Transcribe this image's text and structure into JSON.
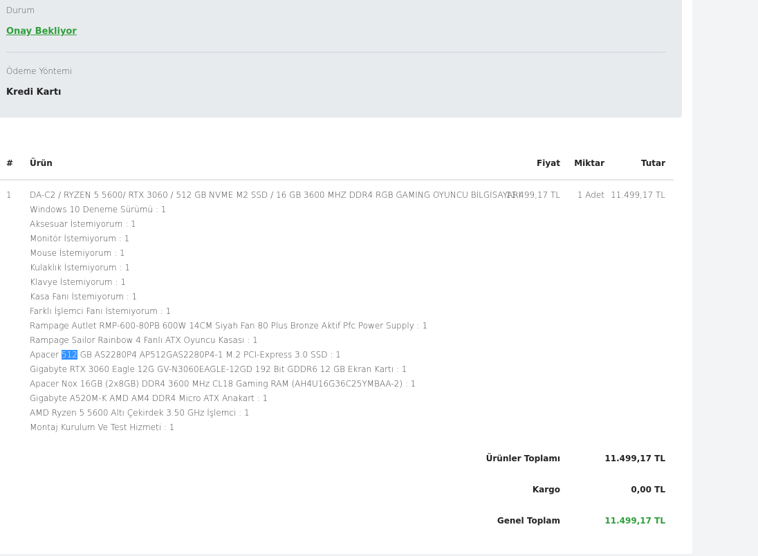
{
  "order": {
    "status_label": "Durum",
    "status_value": "Onay Bekliyor",
    "payment_label": "Ödeme Yöntemi",
    "payment_value": "Kredi Kartı"
  },
  "table": {
    "headers": {
      "index": "#",
      "product": "Ürün",
      "price": "Fiyat",
      "quantity": "Miktar",
      "total": "Tutar"
    },
    "row": {
      "index": "1",
      "product": "DA-C2 / RYZEN 5 5600/ RTX 3060 / 512 GB NVME M2 SSD / 16 GB 3600 MHZ DDR4 RGB GAMING OYUNCU BİLGİSAYARI",
      "price": "11.499,17 TL",
      "quantity": "1 Adet",
      "total": "11.499,17 TL",
      "options": [
        "Windows 10 Deneme Sürümü : 1",
        "Aksesuar İstemiyorum : 1",
        "Monitör İstemiyorum : 1",
        "Mouse İstemiyorum : 1",
        "Kulaklık İstemiyorum : 1",
        "Klavye İstemiyorum : 1",
        "Kasa Fanı İstemiyorum : 1",
        "Farklı İşlemci Fanı İstemiyorum : 1",
        "Rampage Autlet RMP-600-80PB 600W 14CM Siyah Fan 80 Plus Bronze Aktif Pfc Power Supply : 1",
        "Rampage Sailor Rainbow 4 Fanlı ATX Oyuncu Kasası : 1",
        "Apacer 512 GB AS2280P4 AP512GAS2280P4-1 M.2 PCI-Express 3.0 SSD : 1",
        "Gigabyte RTX 3060 Eagle 12G GV-N3060EAGLE-12GD 192 Bit GDDR6 12 GB Ekran Kartı : 1",
        "Apacer Nox 16GB (2x8GB) DDR4 3600 MHz CL18 Gaming RAM (AH4U16G36C25YMBAA-2) : 1",
        "Gigabyte A520M-K AMD AM4 DDR4 Micro ATX Anakart : 1",
        "AMD Ryzen 5 5600 Altı Çekirdek 3.50 GHz İşlemci : 1",
        "Montaj Kurulum Ve Test Hizmeti : 1"
      ],
      "ssd_prefix": "Apacer ",
      "ssd_selected": "512",
      "ssd_suffix": " GB AS2280P4 AP512GAS2280P4-1 M.2 PCI-Express 3.0 SSD : 1"
    }
  },
  "totals": {
    "subtotal_label": "Ürünler Toplamı",
    "subtotal_value": "11.499,17 TL",
    "shipping_label": "Kargo",
    "shipping_value": "0,00 TL",
    "grand_label": "Genel Toplam",
    "grand_value": "11.499,17 TL"
  },
  "colors": {
    "accent_green": "#2e9e3c",
    "card_bg": "#e8ebee",
    "selection": "#3390ff"
  }
}
